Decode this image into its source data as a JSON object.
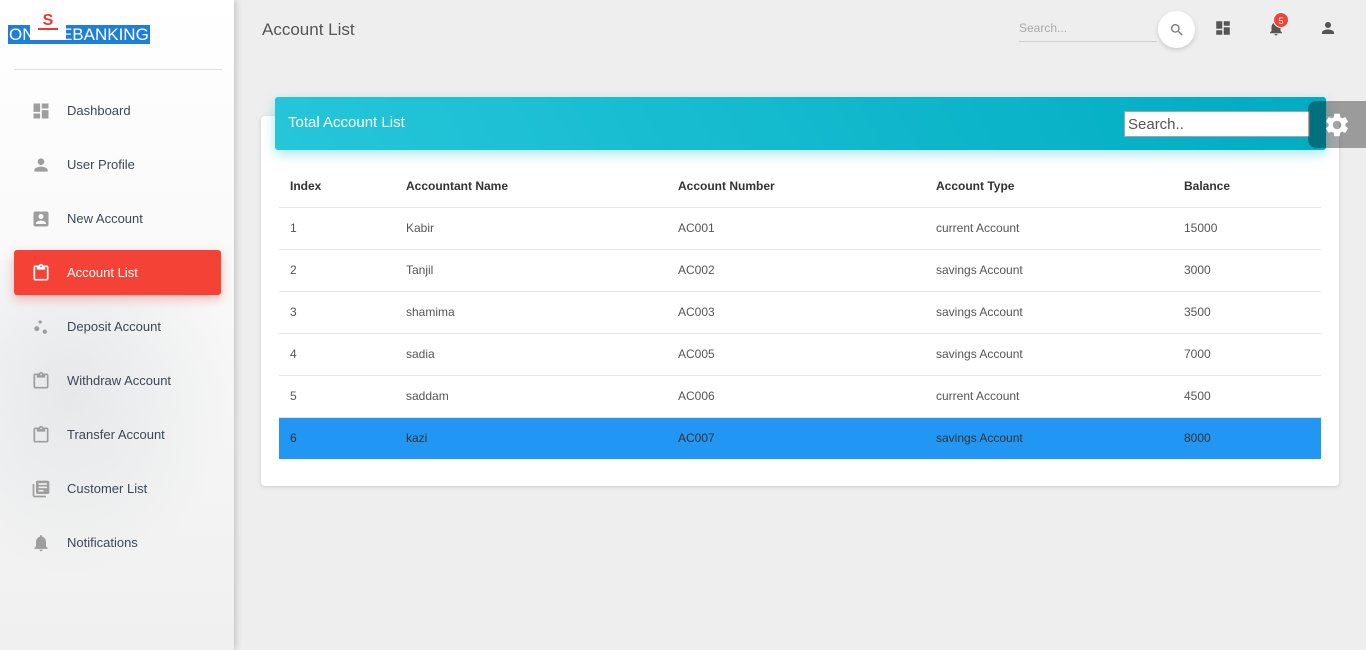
{
  "brand": {
    "text": "ONLINEBANKING",
    "logo_letter": "S"
  },
  "colors": {
    "accent": "#f44336",
    "header": "#00bcd4",
    "selected_row": "#2196f3",
    "brand": "#1e7fd8"
  },
  "sidebar": {
    "items": [
      {
        "label": "Dashboard",
        "icon": "dashboard-icon",
        "active": false
      },
      {
        "label": "User Profile",
        "icon": "person-icon",
        "active": false
      },
      {
        "label": "New Account",
        "icon": "account-box-icon",
        "active": false
      },
      {
        "label": "Account List",
        "icon": "clipboard-icon",
        "active": true
      },
      {
        "label": "Deposit Account",
        "icon": "bubbles-icon",
        "active": false
      },
      {
        "label": "Withdraw Account",
        "icon": "clipboard-icon",
        "active": false
      },
      {
        "label": "Transfer Account",
        "icon": "clipboard-icon",
        "active": false
      },
      {
        "label": "Customer List",
        "icon": "library-books-icon",
        "active": false
      },
      {
        "label": "Notifications",
        "icon": "bell-icon",
        "active": false
      }
    ]
  },
  "header": {
    "title": "Account List",
    "search_placeholder": "Search...",
    "notification_count": "5"
  },
  "card": {
    "title": "Total Account List",
    "search_placeholder": "Search..",
    "columns": [
      "Index",
      "Accountant Name",
      "Account Number",
      "Account Type",
      "Balance"
    ],
    "rows": [
      [
        "1",
        "Kabir",
        "AC001",
        "current Account",
        "15000"
      ],
      [
        "2",
        "Tanjil",
        "AC002",
        "savings Account",
        "3000"
      ],
      [
        "3",
        "shamima",
        "AC003",
        "savings Account",
        "3500"
      ],
      [
        "4",
        "sadia",
        "AC005",
        "savings Account",
        "7000"
      ],
      [
        "5",
        "saddam",
        "AC006",
        "current Account",
        "4500"
      ],
      [
        "6",
        "kazi",
        "AC007",
        "savings Account",
        "8000"
      ]
    ],
    "selected_row": 5
  }
}
